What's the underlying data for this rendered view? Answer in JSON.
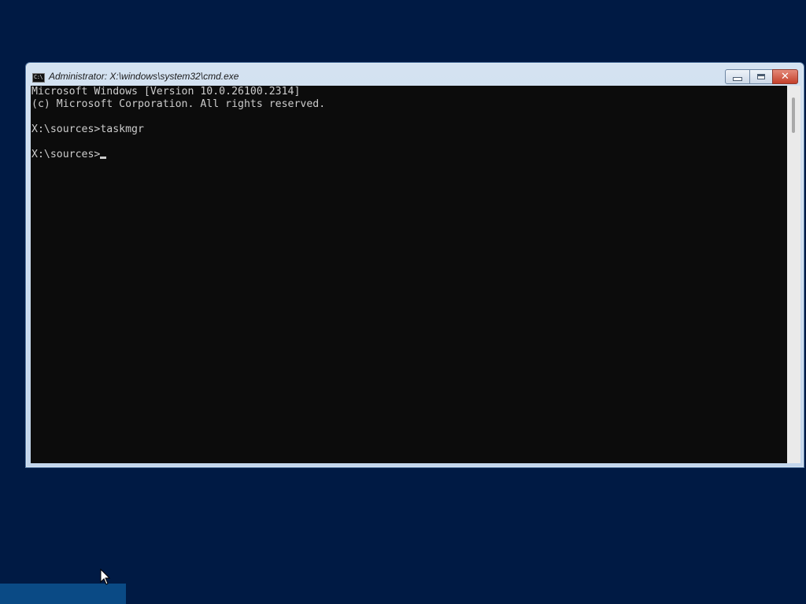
{
  "window": {
    "title": "Administrator: X:\\windows\\system32\\cmd.exe",
    "icon": "cmd-icon",
    "buttons": {
      "minimize": "minimize-icon",
      "maximize": "maximize-icon",
      "close": "close-icon"
    }
  },
  "console": {
    "lines": [
      "Microsoft Windows [Version 10.0.26100.2314]",
      "(c) Microsoft Corporation. All rights reserved.",
      "",
      "X:\\sources>taskmgr",
      "",
      "X:\\sources>"
    ],
    "foreground": "#cccccc",
    "background": "#0c0c0c"
  },
  "desktop": {
    "background": "#001a44"
  }
}
